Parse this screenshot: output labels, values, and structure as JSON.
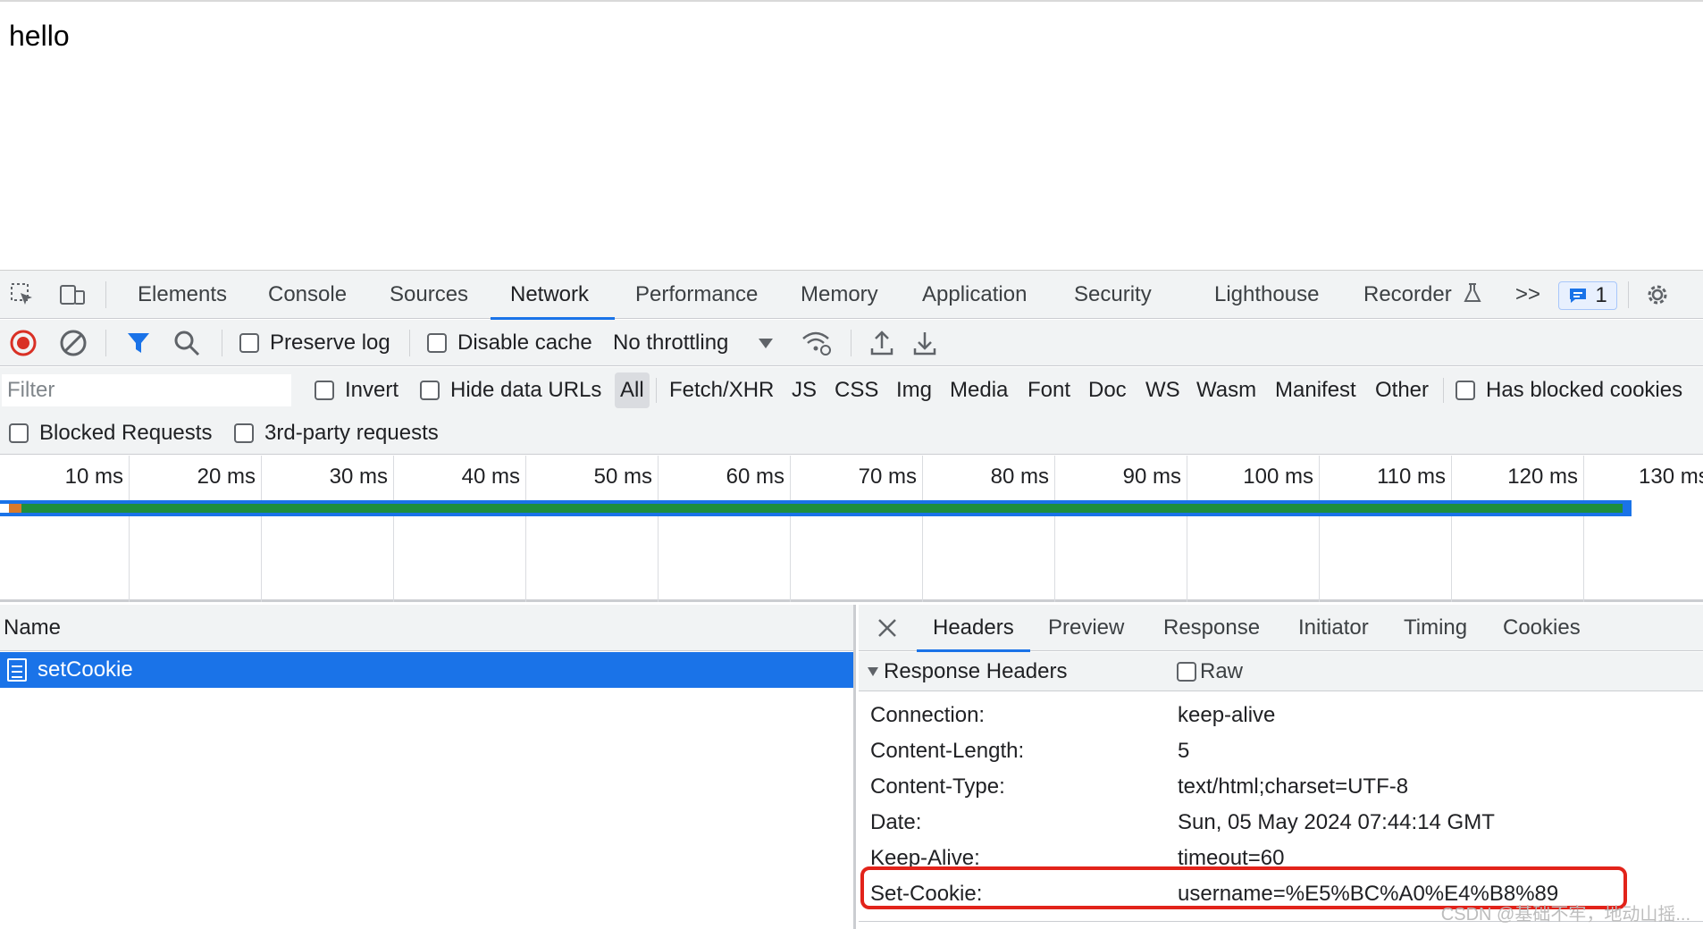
{
  "page": {
    "text": "hello"
  },
  "devtools": {
    "tabs": [
      "Elements",
      "Console",
      "Sources",
      "Network",
      "Performance",
      "Memory",
      "Application",
      "Security",
      "Lighthouse",
      "Recorder"
    ],
    "active_tab": "Network",
    "more_icon": ">>",
    "issues_count": "1"
  },
  "toolbar": {
    "preserve_log": "Preserve log",
    "disable_cache": "Disable cache",
    "throttling": "No throttling"
  },
  "filter": {
    "placeholder": "Filter",
    "invert": "Invert",
    "hide_data_urls": "Hide data URLs",
    "types": [
      "All",
      "Fetch/XHR",
      "JS",
      "CSS",
      "Img",
      "Media",
      "Font",
      "Doc",
      "WS",
      "Wasm",
      "Manifest",
      "Other"
    ],
    "has_blocked_cookies": "Has blocked cookies",
    "blocked_requests": "Blocked Requests",
    "third_party": "3rd-party requests"
  },
  "overview": {
    "ticks": [
      "10 ms",
      "20 ms",
      "30 ms",
      "40 ms",
      "50 ms",
      "60 ms",
      "70 ms",
      "80 ms",
      "90 ms",
      "100 ms",
      "110 ms",
      "120 ms",
      "130 ms"
    ]
  },
  "requests": {
    "column_name": "Name",
    "rows": [
      {
        "name": "setCookie",
        "selected": true
      }
    ]
  },
  "details": {
    "tabs": [
      "Headers",
      "Preview",
      "Response",
      "Initiator",
      "Timing",
      "Cookies"
    ],
    "active_tab": "Headers",
    "section_title": "Response Headers",
    "raw_label": "Raw",
    "headers": [
      {
        "name": "Connection:",
        "value": "keep-alive"
      },
      {
        "name": "Content-Length:",
        "value": "5"
      },
      {
        "name": "Content-Type:",
        "value": "text/html;charset=UTF-8"
      },
      {
        "name": "Date:",
        "value": "Sun, 05 May 2024 07:44:14 GMT"
      },
      {
        "name": "Keep-Alive:",
        "value": "timeout=60"
      },
      {
        "name": "Set-Cookie:",
        "value": "username=%E5%BC%A0%E4%B8%89"
      }
    ]
  },
  "watermark": "CSDN @基础不牢，地动山摇..."
}
